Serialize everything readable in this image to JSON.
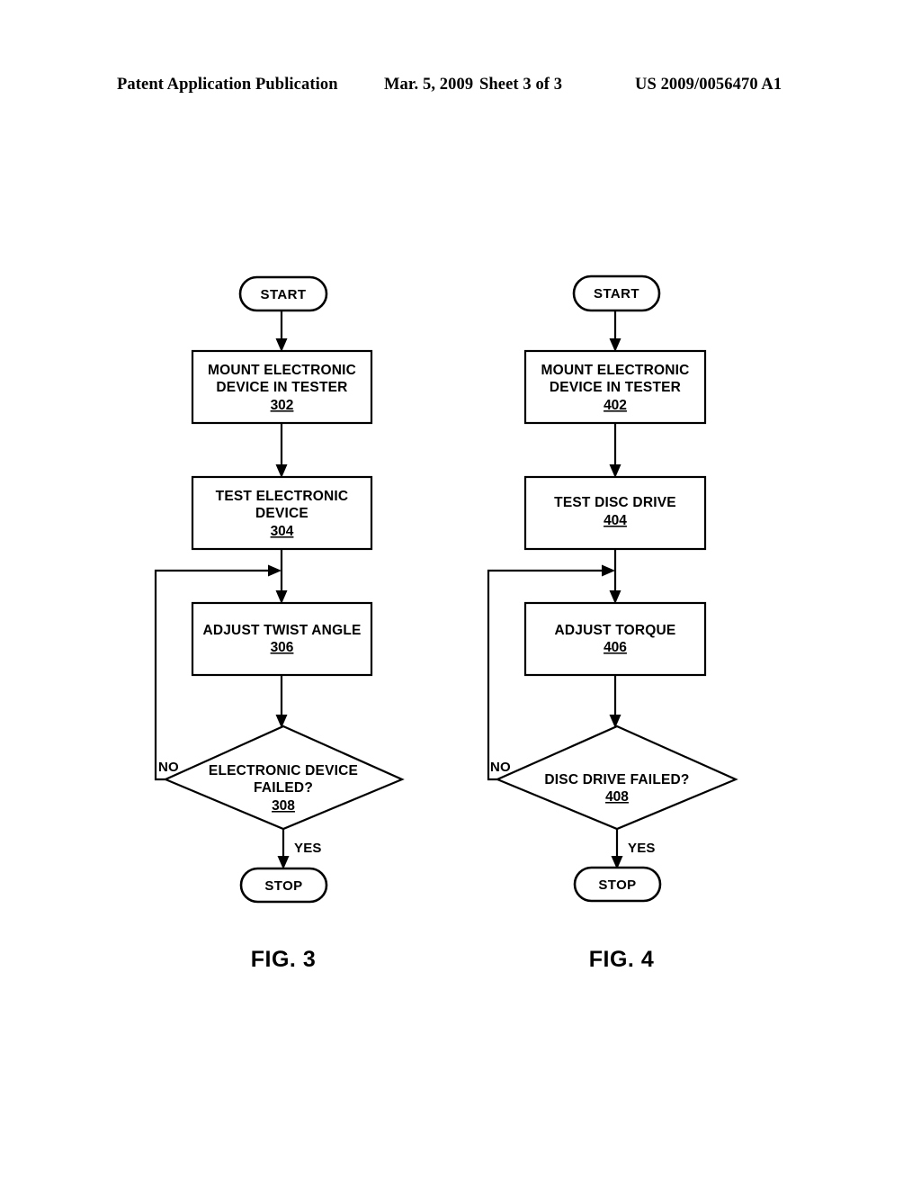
{
  "header": {
    "publication": "Patent Application Publication",
    "date": "Mar. 5, 2009",
    "sheet": "Sheet 3 of 3",
    "patent_number": "US 2009/0056470 A1"
  },
  "figures": [
    {
      "caption": "FIG. 3",
      "nodes": {
        "start": "START",
        "step1_line1": "MOUNT ELECTRONIC",
        "step1_line2": "DEVICE  IN TESTER",
        "step1_ref": "302",
        "step2_line1": "TEST ELECTRONIC",
        "step2_line2": "DEVICE",
        "step2_ref": "304",
        "step3_line1": "ADJUST TWIST ANGLE",
        "step3_ref": "306",
        "decision_line1": "ELECTRONIC DEVICE",
        "decision_line2": "FAILED?",
        "decision_ref": "308",
        "stop": "STOP"
      },
      "edges": {
        "no": "NO",
        "yes": "YES"
      }
    },
    {
      "caption": "FIG. 4",
      "nodes": {
        "start": "START",
        "step1_line1": "MOUNT ELECTRONIC",
        "step1_line2": "DEVICE  IN TESTER",
        "step1_ref": "402",
        "step2_line1": "TEST DISC DRIVE",
        "step2_line2": "",
        "step2_ref": "404",
        "step3_line1": "ADJUST TORQUE",
        "step3_ref": "406",
        "decision_line1": "DISC DRIVE FAILED?",
        "decision_line2": "",
        "decision_ref": "408",
        "stop": "STOP"
      },
      "edges": {
        "no": "NO",
        "yes": "YES"
      }
    }
  ],
  "colors": {
    "ink": "#000000",
    "paper": "#ffffff"
  }
}
